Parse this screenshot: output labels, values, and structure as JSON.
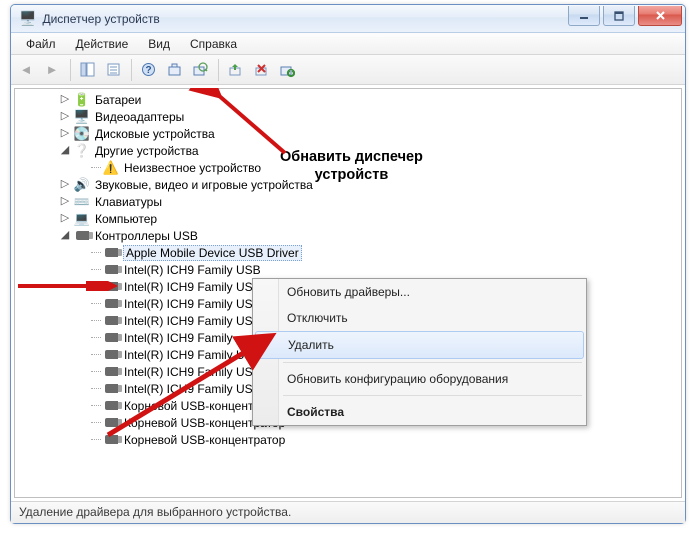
{
  "window": {
    "title": "Диспетчер устройств"
  },
  "menu": {
    "file": "Файл",
    "action": "Действие",
    "view": "Вид",
    "help": "Справка"
  },
  "tree": {
    "batteries": "Батареи",
    "videoadapters": "Видеоадаптеры",
    "diskdrives": "Дисковые устройства",
    "other": "Другие устройства",
    "unknown": "Неизвестное устройство",
    "sound": "Звуковые, видео и игровые устройства",
    "keyboards": "Клавиатуры",
    "computer": "Компьютер",
    "usbctrl": "Контроллеры USB",
    "apple": "Apple Mobile Device USB Driver",
    "ich9a": "Intel(R) ICH9 Family USB",
    "ich9b": "Intel(R) ICH9 Family USB",
    "ich9c": "Intel(R) ICH9 Family USB",
    "ich9d": "Intel(R) ICH9 Family USB",
    "ich9e": "Intel(R) ICH9 Family",
    "ich9f": "Intel(R) ICH9 Family USB",
    "ich9g": "Intel(R) ICH9 Family USB",
    "ich9host": "Intel(R) ICH9 Family USB2 Enhanced Host Controller - 293C",
    "roothub1": "Корневой USB-концентратор",
    "roothub2": "Корневой USB-концентратор",
    "roothub3": "Корневой USB-концентратор"
  },
  "ctx": {
    "update": "Обновить драйверы...",
    "disable": "Отключить",
    "uninstall": "Удалить",
    "scan": "Обновить конфигурацию оборудования",
    "props": "Свойства"
  },
  "status": "Удаление драйвера для выбранного устройства.",
  "annotation": {
    "l1": "Обнавить диспечер",
    "l2": "устройств"
  }
}
